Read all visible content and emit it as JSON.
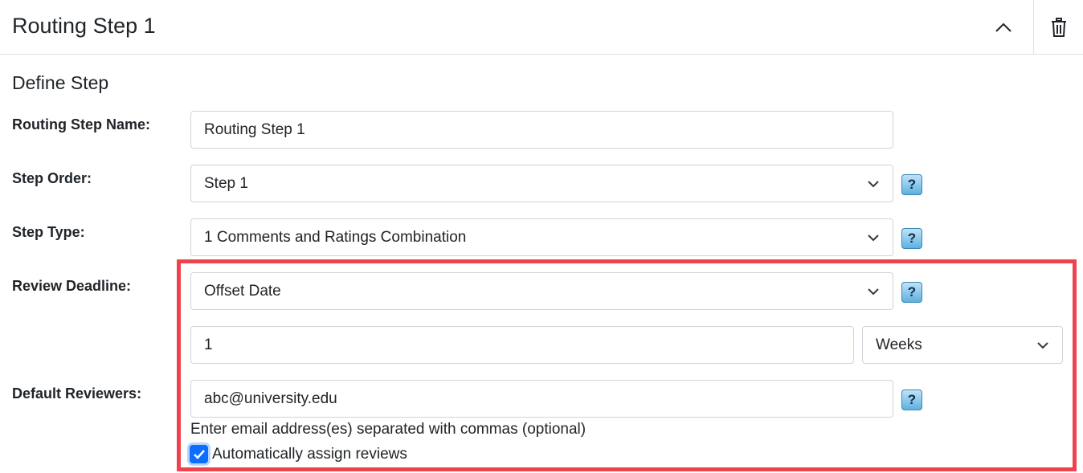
{
  "header": {
    "title": "Routing Step 1",
    "collapse_icon": "chevron-up-icon",
    "delete_icon": "trash-icon"
  },
  "section": {
    "title": "Define Step"
  },
  "labels": {
    "step_name": "Routing Step Name:",
    "step_order": "Step Order:",
    "step_type": "Step Type:",
    "review_deadline": "Review Deadline:",
    "default_reviewers": "Default Reviewers:"
  },
  "fields": {
    "step_name": "Routing Step 1",
    "step_order": "Step 1",
    "step_type": "1 Comments and Ratings Combination",
    "deadline_type": "Offset Date",
    "offset_value": "1",
    "offset_unit": "Weeks",
    "reviewers": "abc@university.edu"
  },
  "help_label": "?",
  "reviewers_hint": "Enter email address(es) separated with commas (optional)",
  "auto_assign": {
    "label": "Automatically assign reviews",
    "checked": true
  },
  "colors": {
    "highlight": "#f0424d",
    "checkbox": "#0d6efd"
  }
}
